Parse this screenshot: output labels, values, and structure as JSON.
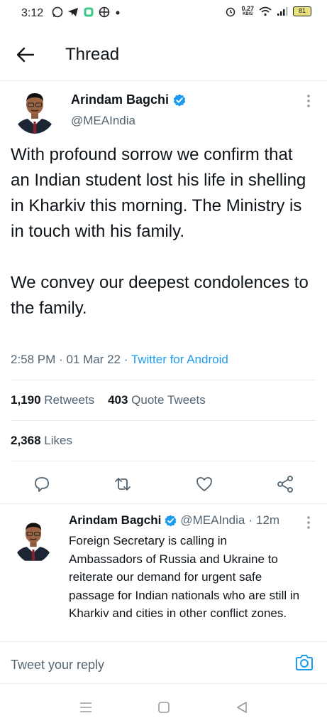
{
  "status_bar": {
    "time": "3:12",
    "net_speed_value": "0.27",
    "net_speed_unit": "KB/S",
    "battery": "81"
  },
  "header": {
    "title": "Thread"
  },
  "main_tweet": {
    "author_name": "Arindam Bagchi",
    "handle": "@MEAIndia",
    "paragraphs": [
      "With profound sorrow we confirm that an Indian student lost his life in shelling in Kharkiv this morning. The Ministry is in touch with his family.",
      "We convey our deepest condolences to the family."
    ],
    "time": "2:58 PM",
    "date": "01 Mar 22",
    "source": "Twitter for Android",
    "retweets_count": "1,190",
    "retweets_label": "Retweets",
    "quotes_count": "403",
    "quotes_label": "Quote Tweets",
    "likes_count": "2,368",
    "likes_label": "Likes"
  },
  "reply_tweet": {
    "author_name": "Arindam Bagchi",
    "handle": "@MEAIndia",
    "age": "12m",
    "text": "Foreign Secretary is calling in Ambassadors of Russia and Ukraine to reiterate our demand for urgent safe passage for Indian nationals who are still in Kharkiv and cities in other conflict zones."
  },
  "reply_box": {
    "placeholder": "Tweet your reply"
  },
  "colors": {
    "accent": "#1d9bf0",
    "secondary_text": "#536471",
    "border": "#e6ecf0"
  }
}
